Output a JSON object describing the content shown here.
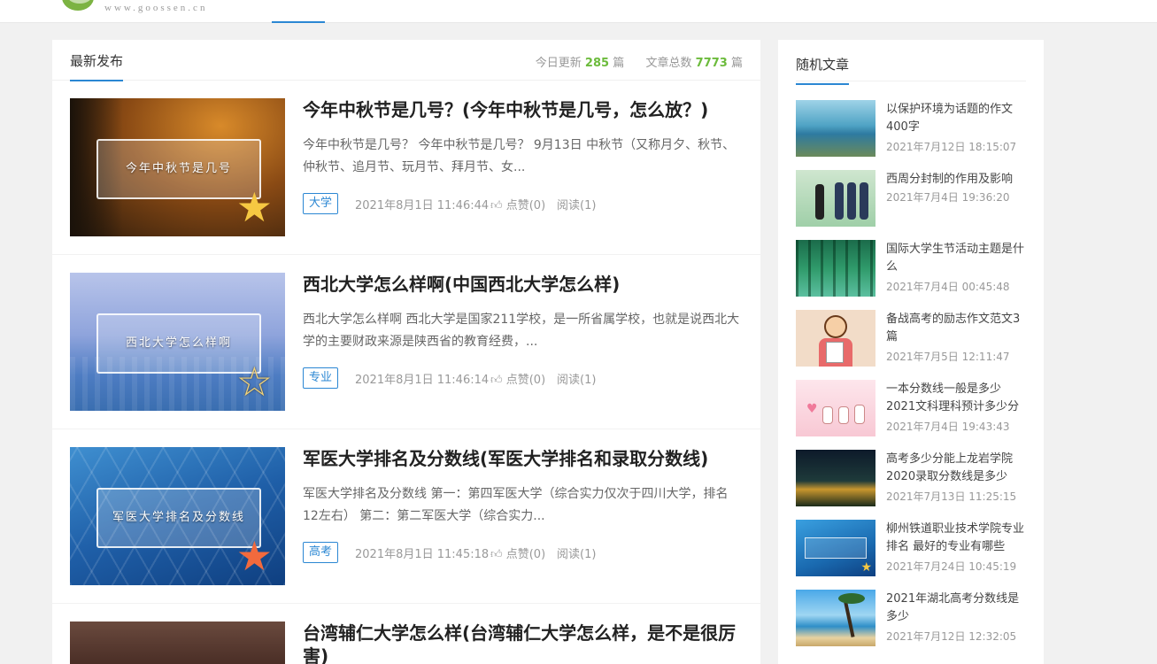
{
  "site": {
    "logo_text": "www.goossen.cn"
  },
  "main": {
    "title": "最新发布",
    "stats": {
      "today_label": "今日更新",
      "today_count": "285",
      "unit": "篇",
      "total_label": "文章总数",
      "total_count": "7773"
    }
  },
  "posts": [
    {
      "title": "今年中秋节是几号？(今年中秋节是几号，怎么放？)",
      "excerpt": "今年中秋节是几号？ 今年中秋节是几号？ 9月13日 中秋节（又称月夕、秋节、仲秋节、追月节、玩月节、拜月节、女...",
      "tag": "大学",
      "date": "2021年8月1日 11:46:44",
      "likes": "点赞(0)",
      "reads": "阅读(1)",
      "thumb_caption": "今年中秋节是几号"
    },
    {
      "title": "西北大学怎么样啊(中国西北大学怎么样)",
      "excerpt": "西北大学怎么样啊 西北大学是国家211学校，是一所省属学校，也就是说西北大学的主要财政来源是陕西省的教育经费，...",
      "tag": "专业",
      "date": "2021年8月1日 11:46:14",
      "likes": "点赞(0)",
      "reads": "阅读(1)",
      "thumb_caption": "西北大学怎么样啊"
    },
    {
      "title": "军医大学排名及分数线(军医大学排名和录取分数线)",
      "excerpt": "军医大学排名及分数线 第一：第四军医大学（综合实力仅次于四川大学，排名12左右） 第二：第二军医大学（综合实力...",
      "tag": "高考",
      "date": "2021年8月1日 11:45:18",
      "likes": "点赞(0)",
      "reads": "阅读(1)",
      "thumb_caption": "军医大学排名及分数线"
    },
    {
      "title": "台湾辅仁大学怎么样(台湾辅仁大学怎么样，是不是很厉害)",
      "excerpt": "",
      "tag": "",
      "date": "",
      "likes": "",
      "reads": "",
      "thumb_caption": ""
    }
  ],
  "sidebar": {
    "title": "随机文章",
    "items": [
      {
        "title": "以保护环境为话题的作文400字",
        "date": "2021年7月12日 18:15:07"
      },
      {
        "title": "西周分封制的作用及影响",
        "date": "2021年7月4日 19:36:20"
      },
      {
        "title": "国际大学生节活动主题是什么",
        "date": "2021年7月4日 00:45:48"
      },
      {
        "title": "备战高考的励志作文范文3篇",
        "date": "2021年7月5日 12:11:47"
      },
      {
        "title": "一本分数线一般是多少2021文科理科预计多少分",
        "date": "2021年7月4日 19:43:43"
      },
      {
        "title": "高考多少分能上龙岩学院2020录取分数线是多少",
        "date": "2021年7月13日 11:25:15"
      },
      {
        "title": "柳州铁道职业技术学院专业排名 最好的专业有哪些",
        "date": "2021年7月24日 10:45:19"
      },
      {
        "title": "2021年湖北高考分数线是多少",
        "date": "2021年7月12日 12:32:05"
      }
    ]
  },
  "colors": {
    "accent": "#2b87d3",
    "stat_number": "#6cbb3c"
  }
}
